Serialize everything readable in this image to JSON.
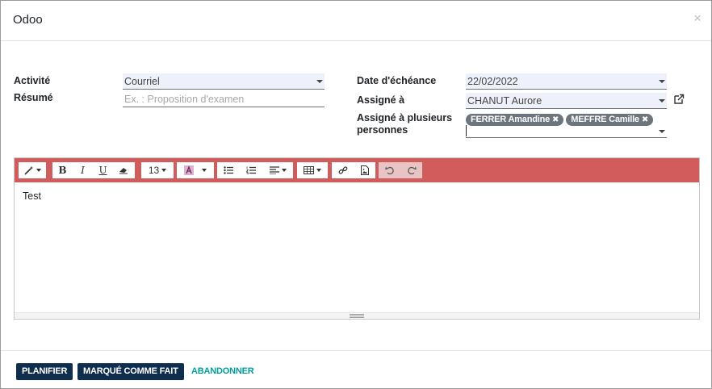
{
  "dialog": {
    "title": "Odoo",
    "close_label": "×"
  },
  "form": {
    "activity": {
      "label": "Activité",
      "value": "Courriel"
    },
    "summary": {
      "label": "Résumé",
      "placeholder": "Ex. : Proposition d'examen"
    },
    "due_date": {
      "label": "Date d'échéance",
      "value": "22/02/2022"
    },
    "assigned_to": {
      "label": "Assigné à",
      "value": "CHANUT Aurore"
    },
    "assigned_multiple": {
      "label_line1": "Assigné à plusieurs",
      "label_line2": "personnes",
      "tags": [
        "FERRER Amandine",
        "MEFFRE Camille"
      ]
    }
  },
  "editor": {
    "toolbar": {
      "font_size": "13"
    },
    "content": "Test",
    "toolbar_color": "#d05c5c"
  },
  "footer": {
    "schedule_label": "PLANIFIER",
    "mark_done_label": "MARQUÉ COMME FAIT",
    "discard_label": "ABANDONNER"
  },
  "colors": {
    "primary": "#0f2e4d",
    "link": "#00a09d"
  }
}
